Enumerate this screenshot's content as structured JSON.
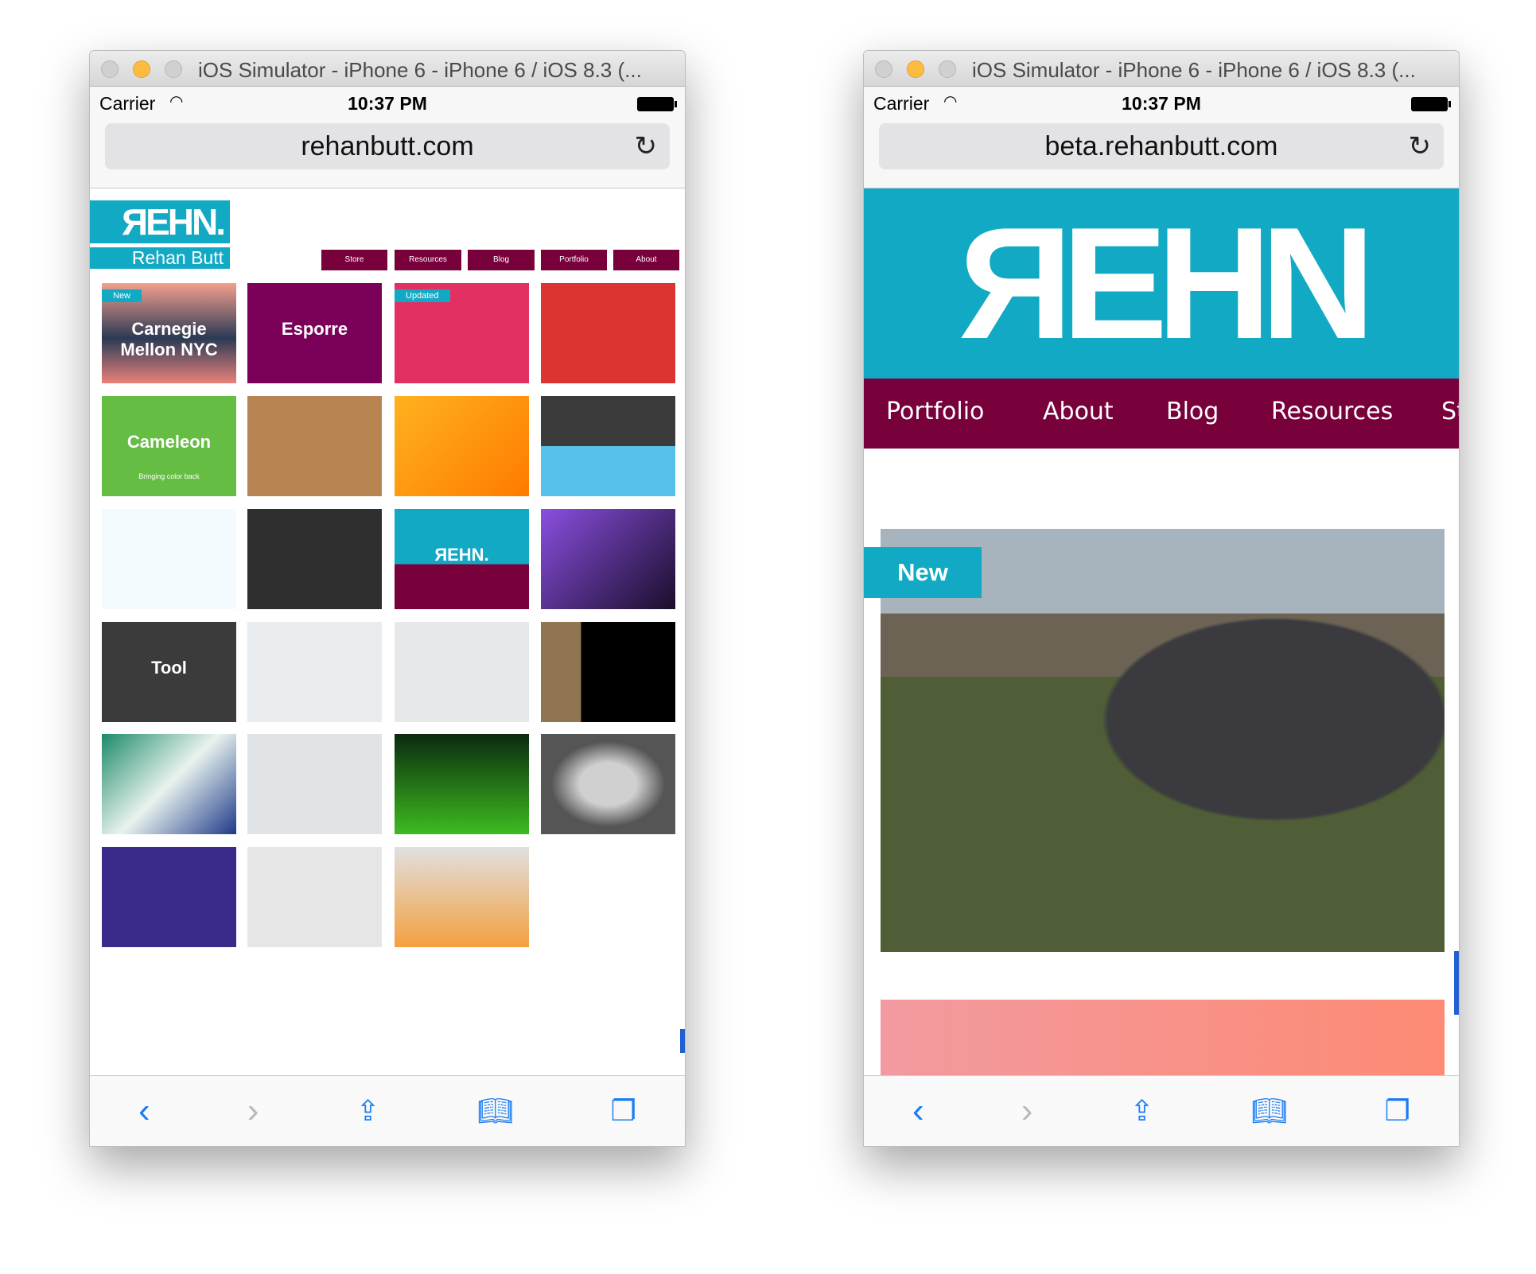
{
  "windows": [
    {
      "title": "iOS Simulator - iPhone 6 - iPhone 6 / iOS 8.3 (...",
      "carrier": "Carrier",
      "time": "10:37 PM",
      "url": "rehanbutt.com"
    },
    {
      "title": "iOS Simulator - iPhone 6 - iPhone 6 / iOS 8.3 (...",
      "carrier": "Carrier",
      "time": "10:37 PM",
      "url": "beta.rehanbutt.com"
    }
  ],
  "old_site": {
    "logo_mark": "ЯEHN.",
    "logo_name": "Rehan Butt",
    "nav": [
      "Store",
      "Resources",
      "Blog",
      "Portfolio",
      "About"
    ],
    "tiles": [
      {
        "badge": "New",
        "text": "Carnegie Mellon NYC",
        "bg": "linear-gradient(#f3a08e,#2b3a55 55%,#e9827a)"
      },
      {
        "text": "Esporre",
        "bg": "#7a005a"
      },
      {
        "badge": "Updated",
        "text": "",
        "bg": "#e23063"
      },
      {
        "text": "",
        "bg": "#dc3431"
      },
      {
        "text": "Cameleon",
        "sub": "Bringing color back",
        "bg": "#65bd44"
      },
      {
        "text": "",
        "bg": "#b88552"
      },
      {
        "text": "",
        "bg": "linear-gradient(135deg,#ffb21f,#ff7b00)"
      },
      {
        "text": "",
        "bg": "linear-gradient(#3b3b3b 50%,#56c2ea 50%)"
      },
      {
        "text": "",
        "bg": "#f4fbfe"
      },
      {
        "text": "",
        "bg": "#2f2f2f"
      },
      {
        "text": "ЯEHN.",
        "bg": "linear-gradient(#12a9c4 55%,#78003b 55%)"
      },
      {
        "text": "",
        "bg": "linear-gradient(135deg,#8a4fe0,#1a0e2a)"
      },
      {
        "text": "Tool",
        "bg": "#3b3b3b"
      },
      {
        "text": "",
        "bg": "#e8ecef"
      },
      {
        "text": "",
        "bg": "#e6e8ea"
      },
      {
        "text": "",
        "bg": "linear-gradient(90deg,#8f7552 30%,#000 30%)"
      },
      {
        "text": "",
        "bg": "linear-gradient(135deg,#1d8a6a,#e9f3ee,#1d3a8a)"
      },
      {
        "text": "",
        "bg": "#e1e4e7"
      },
      {
        "text": "",
        "bg": "linear-gradient(#0b2a0f,#3dbb20)"
      },
      {
        "text": "",
        "bg": "radial-gradient(#d0d0d0 30%,#555 60%)"
      },
      {
        "text": "",
        "bg": "#3a2a8a"
      },
      {
        "text": "",
        "bg": "#e6e6e6"
      },
      {
        "text": "",
        "bg": "linear-gradient(#e0e0e0,#f4a040)"
      }
    ]
  },
  "new_site": {
    "logo_mark": "ЯEHN",
    "nav": [
      "Portfolio",
      "About",
      "Blog",
      "Resources",
      "St"
    ],
    "badge": "New"
  },
  "toolbar_icons": [
    "back-icon",
    "forward-icon",
    "share-icon",
    "bookmarks-icon",
    "tabs-icon"
  ],
  "colors": {
    "teal": "#12a9c4",
    "maroon": "#78003b",
    "ios_blue": "#1a7cf4"
  }
}
